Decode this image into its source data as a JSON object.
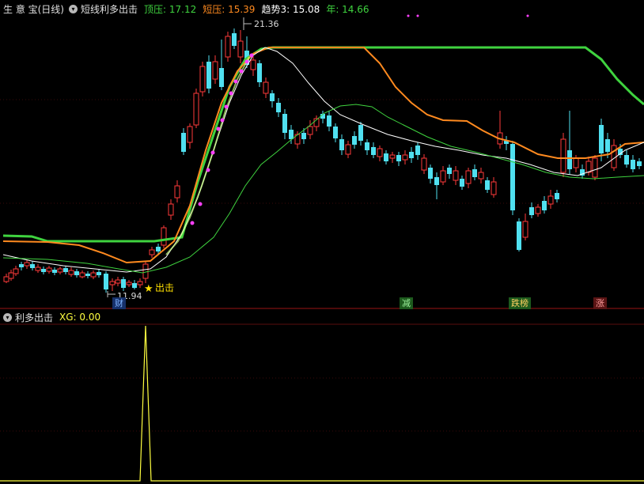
{
  "header": {
    "title": "生 意 宝(日线)",
    "indicator_name": "短线利多出击",
    "items": [
      {
        "label": "顶压: 17.12",
        "color": "#3fd33f"
      },
      {
        "label": "短压: 15.39",
        "color": "#ff8a1f"
      },
      {
        "label": "趋势3: 15.08",
        "color": "#ffffff"
      },
      {
        "label": "年: 14.66",
        "color": "#3fd33f"
      }
    ]
  },
  "annotations": {
    "high_price": "21.36",
    "low_price": "11.94",
    "signal_label": "出击"
  },
  "tags": [
    {
      "label": "财",
      "bg": "#16306a",
      "color": "#7fb2ff"
    },
    {
      "label": "减",
      "bg": "#1d5a1d",
      "color": "#9cf29c"
    },
    {
      "label": "跌榜",
      "bg": "#1d5a1d",
      "color": "#ffd060"
    },
    {
      "label": "涨",
      "bg": "#5a1414",
      "color": "#ff9d9d"
    }
  ],
  "sub_panel": {
    "title": "利多出击",
    "value_label": "XG: 0.00"
  },
  "colors": {
    "up": "#ff3a3a",
    "down": "#50e0f0",
    "panel_divider": "#9a1414"
  }
}
